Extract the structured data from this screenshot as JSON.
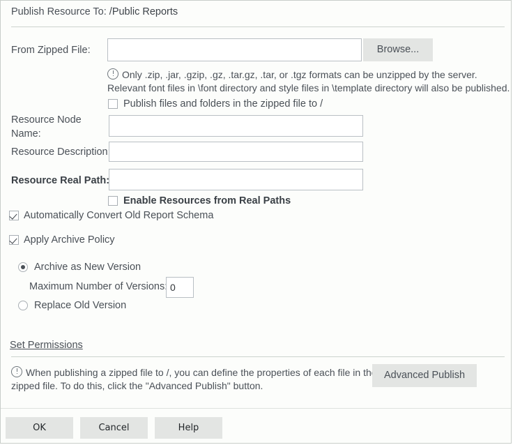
{
  "dialog": {
    "title_prefix": "Publish Resource To:",
    "title_path": "/Public Reports"
  },
  "zipped_file": {
    "label": "From Zipped File:",
    "value": "",
    "browse_label": "Browse..."
  },
  "zip_note": {
    "line1": "Only .zip, .jar, .gzip, .gz, .tar.gz, .tar, or .tgz formats can be unzipped by the server.",
    "line2": "Relevant font files in \\font directory and style files in \\template directory will also be published."
  },
  "publish_to_root": {
    "label": "Publish files and folders in the zipped file to /",
    "checked": false
  },
  "resource_node_name": {
    "label_line1": "Resource Node",
    "label_line2": "Name:",
    "value": ""
  },
  "resource_description": {
    "label": "Resource Description:",
    "value": ""
  },
  "resource_real_path": {
    "label": "Resource Real Path:",
    "value": ""
  },
  "enable_real_paths": {
    "label": "Enable Resources from Real Paths",
    "checked": false
  },
  "auto_convert": {
    "label": "Automatically Convert Old Report Schema",
    "checked": true
  },
  "archive_policy": {
    "label": "Apply Archive Policy",
    "checked": true,
    "options": [
      {
        "label": "Archive as New Version",
        "selected": true
      },
      {
        "label": "Replace Old Version",
        "selected": false
      }
    ],
    "max_versions": {
      "label": "Maximum Number of Versions:",
      "value": "0"
    }
  },
  "permissions": {
    "link_label": "Set Permissions"
  },
  "advanced_note": {
    "line1": "When publishing a zipped file to /, you can define the properties of each file in the",
    "line2": "zipped file. To do this, click the \"Advanced Publish\" button.",
    "button_label": "Advanced Publish"
  },
  "footer": {
    "ok_label": "OK",
    "cancel_label": "Cancel",
    "help_label": "Help"
  },
  "icons": {
    "info": "info-circle-icon",
    "check": "checkmark-icon"
  },
  "colors": {
    "background": "#fcfdfb",
    "text": "#4a5057",
    "border": "#c8cdc9",
    "button_face": "#e3e5e3",
    "input_border": "#b9bfc4"
  }
}
